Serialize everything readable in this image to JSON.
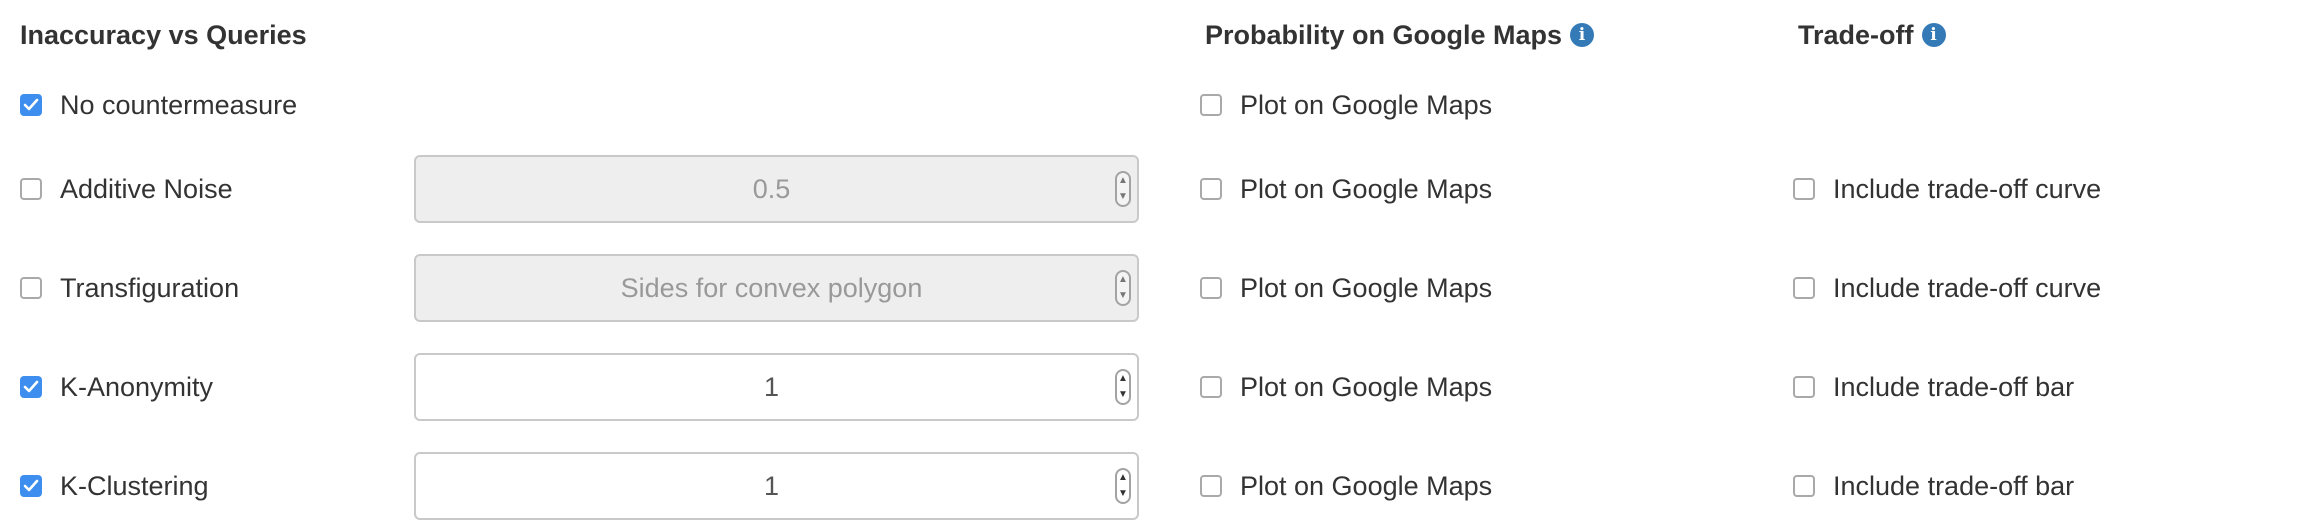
{
  "headers": {
    "inaccuracy": "Inaccuracy vs Queries",
    "probability": "Probability on Google Maps",
    "tradeoff": "Trade-off"
  },
  "icons": {
    "info": "info-icon",
    "check": "checkmark-icon",
    "spinner": "spinner-arrows-icon"
  },
  "colors": {
    "checkbox_checked": "#3d8eef",
    "info_icon": "#337ab7",
    "disabled_field_bg": "#eeeeee"
  },
  "info_glyph": "i",
  "rows": [
    {
      "countermeasure": {
        "label": "No countermeasure",
        "checked": true
      },
      "maps": {
        "label": "Plot on Google Maps",
        "checked": false
      }
    },
    {
      "countermeasure": {
        "label": "Additive Noise",
        "checked": false
      },
      "param": {
        "value": "0.5",
        "disabled": true
      },
      "maps": {
        "label": "Plot on Google Maps",
        "checked": false
      },
      "tradeoff": {
        "label": "Include trade-off curve",
        "checked": false
      }
    },
    {
      "countermeasure": {
        "label": "Transfiguration",
        "checked": false
      },
      "param": {
        "placeholder": "Sides for convex polygon",
        "disabled": true
      },
      "maps": {
        "label": "Plot on Google Maps",
        "checked": false
      },
      "tradeoff": {
        "label": "Include trade-off curve",
        "checked": false
      }
    },
    {
      "countermeasure": {
        "label": "K-Anonymity",
        "checked": true
      },
      "param": {
        "value": "1",
        "disabled": false
      },
      "maps": {
        "label": "Plot on Google Maps",
        "checked": false
      },
      "tradeoff": {
        "label": "Include trade-off bar",
        "checked": false
      }
    },
    {
      "countermeasure": {
        "label": "K-Clustering",
        "checked": true
      },
      "param": {
        "value": "1",
        "disabled": false
      },
      "maps": {
        "label": "Plot on Google Maps",
        "checked": false
      },
      "tradeoff": {
        "label": "Include trade-off bar",
        "checked": false
      }
    }
  ],
  "spinner": {
    "up": "▲",
    "down": "▼"
  }
}
